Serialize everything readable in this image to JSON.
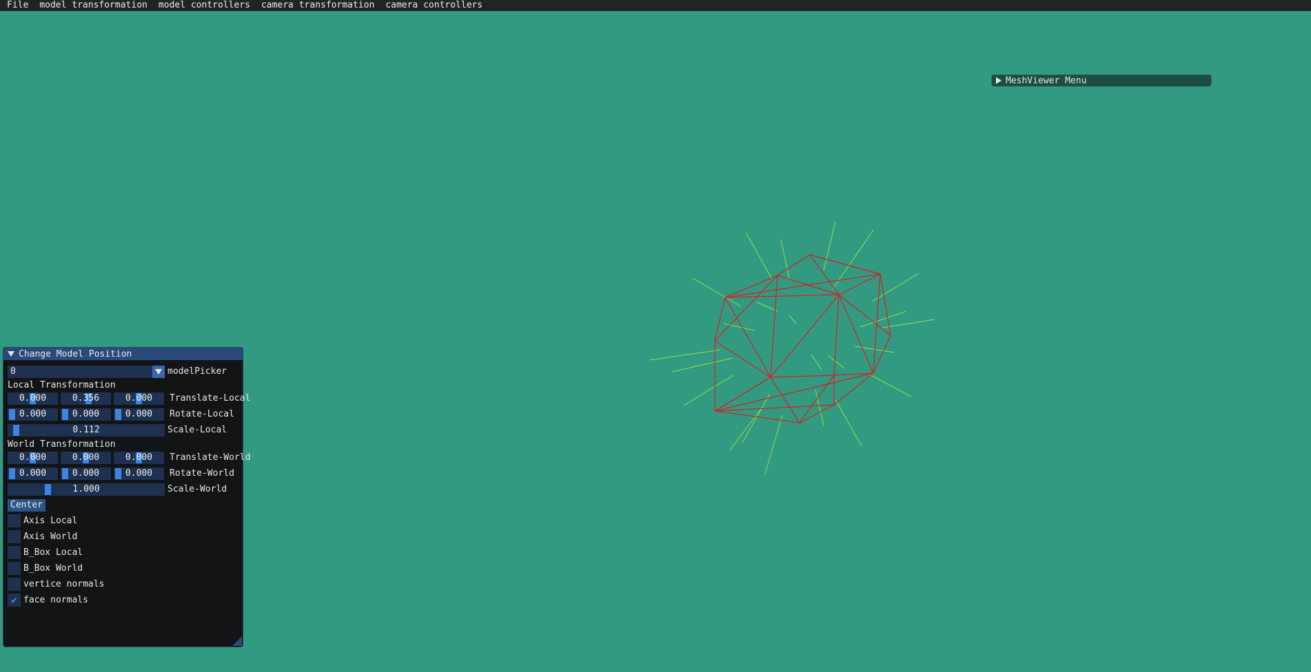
{
  "menubar": {
    "items": [
      "File",
      "model transformation",
      "model controllers",
      "camera transformation",
      "camera controllers"
    ]
  },
  "meshviewer_window": {
    "title": "MeshViewer Menu"
  },
  "model_panel": {
    "title": "Change Model Position",
    "model_picker": {
      "value": "0",
      "label": "modelPicker"
    },
    "local_heading": "Local Transformation",
    "translate_local": {
      "values": [
        "0.000",
        "0.356",
        "0.000"
      ],
      "label": "Translate-Local"
    },
    "rotate_local": {
      "values": [
        "0.000",
        "0.000",
        "0.000"
      ],
      "label": "Rotate-Local"
    },
    "scale_local": {
      "value": "0.112",
      "label": "Scale-Local"
    },
    "world_heading": "World Transformation",
    "translate_world": {
      "values": [
        "0.000",
        "0.000",
        "0.000"
      ],
      "label": "Translate-World"
    },
    "rotate_world": {
      "values": [
        "0.000",
        "0.000",
        "0.000"
      ],
      "label": "Rotate-World"
    },
    "scale_world": {
      "value": "1.000",
      "label": "Scale-World"
    },
    "center_button": "Center",
    "checkboxes": [
      {
        "label": "Axis Local",
        "checked": false
      },
      {
        "label": "Axis World",
        "checked": false
      },
      {
        "label": "B_Box Local",
        "checked": false
      },
      {
        "label": "B_Box World",
        "checked": false
      },
      {
        "label": "vertice normals",
        "checked": false
      },
      {
        "label": "face normals",
        "checked": true
      }
    ]
  },
  "colors": {
    "background": "#339a82",
    "mesh_edges": "#d42020",
    "face_normals": "#8fe04a",
    "panel_title": "#294a7a",
    "slider_grab": "#3d85e0"
  }
}
